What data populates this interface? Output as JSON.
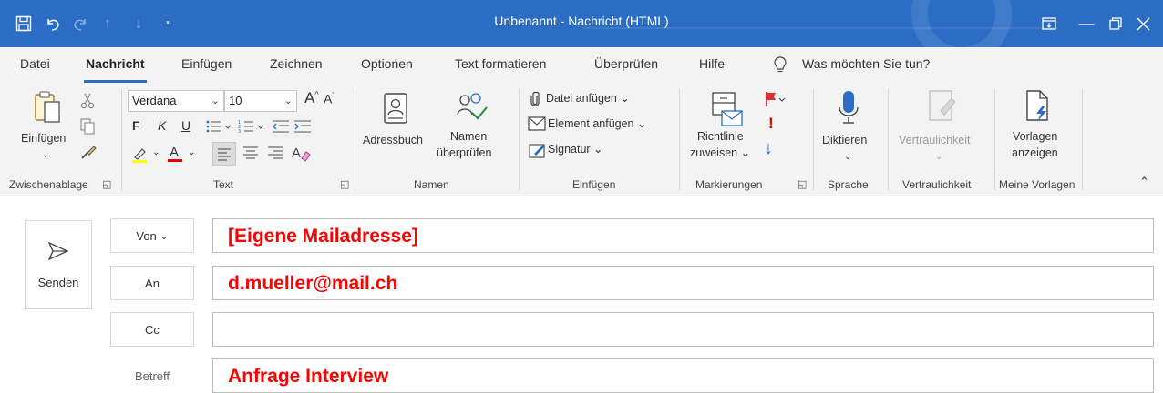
{
  "window": {
    "title": "Unbenannt  -  Nachricht (HTML)",
    "accent": "#2b6cc4"
  },
  "quick_access": [
    "save-icon",
    "undo-icon",
    "redo-icon",
    "arrow-up-icon",
    "arrow-down-icon",
    "customize-icon"
  ],
  "tabs": [
    {
      "label": "Datei"
    },
    {
      "label": "Nachricht",
      "active": true
    },
    {
      "label": "Einfügen"
    },
    {
      "label": "Zeichnen"
    },
    {
      "label": "Optionen"
    },
    {
      "label": "Text formatieren"
    },
    {
      "label": "Überprüfen"
    },
    {
      "label": "Hilfe"
    }
  ],
  "tell_me": "Was möchten Sie tun?",
  "ribbon": {
    "clipboard": {
      "paste_label": "Einfügen",
      "group": "Zwischenablage"
    },
    "text": {
      "font": "Verdana",
      "size": "10",
      "bold": "F",
      "italic": "K",
      "underline": "U",
      "group": "Text"
    },
    "names": {
      "addressbook": "Adressbuch",
      "check_names_1": "Namen",
      "check_names_2": "überprüfen",
      "group": "Namen"
    },
    "insert": {
      "attach_file": "Datei anfügen",
      "attach_item": "Element anfügen",
      "signature": "Signatur",
      "group": "Einfügen"
    },
    "tags": {
      "policy_1": "Richtlinie",
      "policy_2": "zuweisen",
      "group": "Markierungen"
    },
    "voice": {
      "dictate": "Diktieren",
      "group": "Sprache"
    },
    "sensitivity": {
      "label": "Vertraulichkeit",
      "group": "Vertraulichkeit"
    },
    "templates": {
      "label_1": "Vorlagen",
      "label_2": "anzeigen",
      "group": "Meine Vorlagen"
    }
  },
  "compose": {
    "send": "Senden",
    "from_button": "Von",
    "to_button": "An",
    "cc_button": "Cc",
    "subject_label": "Betreff",
    "from_value": "[Eigene Mailadresse]",
    "to_value": "d.mueller@mail.ch",
    "cc_value": "",
    "subject_value": "Anfrage Interview",
    "annotation_color": "#ff0000"
  }
}
